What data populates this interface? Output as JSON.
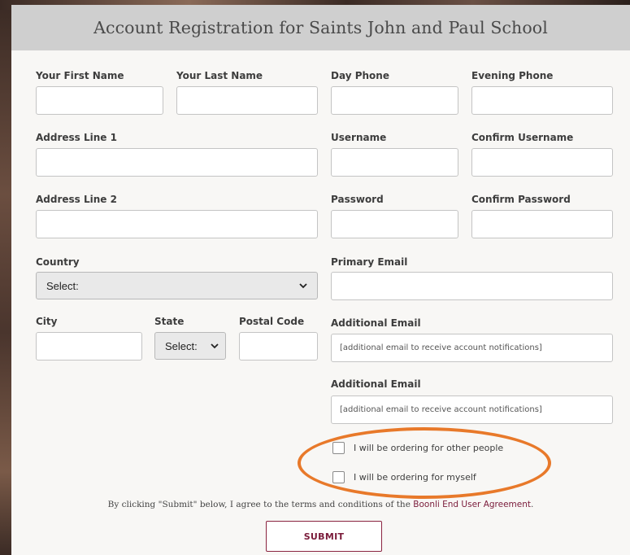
{
  "header": {
    "title": "Account Registration for Saints John and Paul School"
  },
  "left": {
    "first_name_label": "Your First Name",
    "last_name_label": "Your Last Name",
    "address1_label": "Address Line 1",
    "address2_label": "Address Line 2",
    "country_label": "Country",
    "country_value": "Select:",
    "city_label": "City",
    "state_label": "State",
    "state_value": "Select:",
    "postal_label": "Postal Code"
  },
  "right": {
    "day_phone_label": "Day Phone",
    "evening_phone_label": "Evening Phone",
    "username_label": "Username",
    "confirm_username_label": "Confirm Username",
    "password_label": "Password",
    "confirm_password_label": "Confirm Password",
    "primary_email_label": "Primary Email",
    "additional_email_label_1": "Additional Email",
    "additional_email_placeholder_1": "[additional email to receive account notifications]",
    "additional_email_label_2": "Additional Email",
    "additional_email_placeholder_2": "[additional email to receive account notifications]"
  },
  "options": {
    "others_label": "I will be ordering for other people",
    "myself_label": "I will be ordering for myself"
  },
  "footer": {
    "agree_text": "By clicking \"Submit\" below, I agree to the terms and conditions of the",
    "agreement_link": "Boonli End User Agreement",
    "agree_period": ".",
    "submit_label": "SUBMIT"
  },
  "colors": {
    "accent": "#7a1b3a",
    "highlight": "#e8792a",
    "header_bg": "#cfcfcf"
  }
}
